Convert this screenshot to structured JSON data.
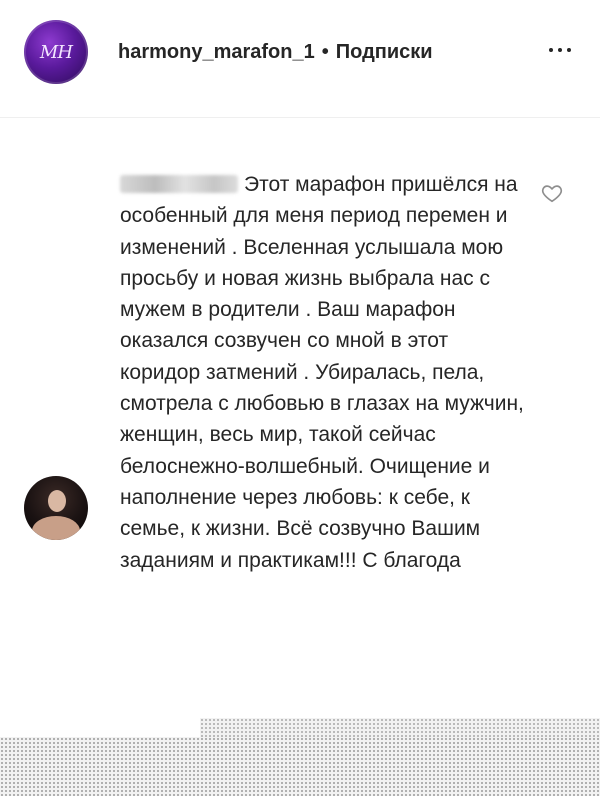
{
  "header": {
    "username": "harmony_marafon_1",
    "separator": "•",
    "follow_status": "Подписки",
    "avatar_monogram": "MH"
  },
  "comment": {
    "text": "Этот марафон пришёлся на особенный для меня период перемен и изменений . Вселенная услышала мою просьбу и новая жизнь выбрала нас с мужем в родители . Ваш марафон оказался созвучен со мной в этот коридор затмений . Убиралась, пела, смотрела с любовью в глазах на мужчин, женщин, весь мир, такой сейчас белоснежно-волшебный. Очищение и наполнение через любовь: к себе, к семье, к жизни. Всё созвучно Вашим заданиям и практикам!!! С благода"
  },
  "icons": {
    "more": "more-options-icon",
    "like": "heart-outline-icon"
  },
  "colors": {
    "text": "#262626",
    "avatar_purple": "#5a1a9c",
    "divider": "#efefef"
  }
}
